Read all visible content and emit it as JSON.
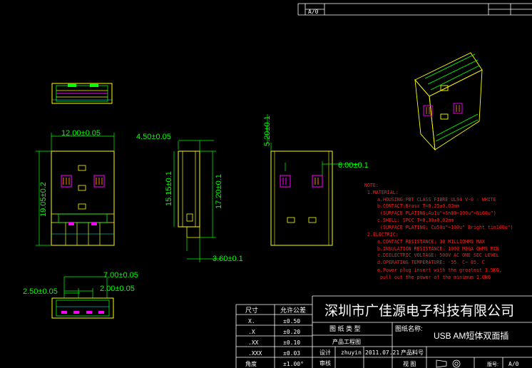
{
  "header_strip": {
    "rev": "A/0"
  },
  "dimensions": {
    "front_width": "12.00±0.05",
    "front_height": "19.05±0.2",
    "side_thickness": "4.50±0.05",
    "side_inner_height": "15.15±0.1",
    "side_outer_height": "17.20±0.1",
    "side_tail": "3.60±0.1",
    "rear_top": "5.20±0.1",
    "rear_window": "6.00±0.1",
    "bottom_span": "7.00±0.05",
    "bottom_left": "2.50±0.05",
    "bottom_mid": "2.00±0.05"
  },
  "notes": {
    "title": "NOTE:",
    "lines": [
      "1.MATERIAL:",
      "a.HOUSING:PBT CLASS FIBRE UL94 V-0 : WHITE",
      "b.CONTACT:Brass T=0.25±0.02mm",
      "(SURFACE PLATING:Au1u\"+Sn80~100u\"+Ni60u\")",
      "c.SHELL: SPCC T=0.30±0.02mm",
      "(SURFACE PLATING: Cu50u\"~100u\"  Bright tin100u\")",
      "2.ELECTRIC:",
      "a.CONTACT RESISTANCE: 30 MILLIOHMS MAX",
      "b.INSULATION RESISTANCE: 1000 MEGA OHMS MIN",
      "c.DIELECTRIC VOLTAGE: 500V AC ONE SEC LEVEL",
      "d.OPERATING TEMPERATURE: -55. C~ 85. C",
      "e.Power plug  insert with the greatest 3.5KG,",
      " pull out the power of the minimum 1.0KG"
    ]
  },
  "tolerance_table": {
    "header": [
      "尺寸",
      "允许公差"
    ],
    "rows": [
      [
        "X.",
        "±0.50"
      ],
      [
        ".X",
        "±0.20"
      ],
      [
        ".XX",
        "±0.10"
      ],
      [
        ".XXX",
        "±0.03"
      ],
      [
        "角度",
        "±1.00°"
      ]
    ]
  },
  "title_block": {
    "company": "深圳市广佳源电子科技有限公司",
    "drawing_type_label": "图 纸 类 型",
    "drawing_name_label": "图纸名称:",
    "drawing_name": "USB AM短体双面插",
    "product_drawing_label": "产品工程图",
    "design_label": "设计",
    "designer": "zhuyin",
    "date": "2011.07.21",
    "part_no_label": "产品料号",
    "review_label": "审核",
    "view_label": "视 图",
    "version_label": "版号:",
    "version": "A/0"
  }
}
